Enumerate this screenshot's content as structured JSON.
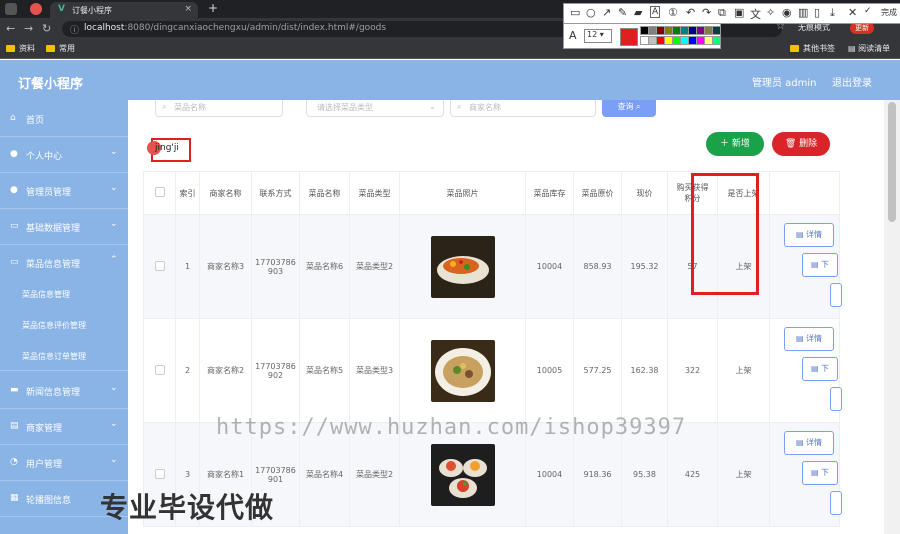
{
  "browser": {
    "tab_title": "订餐小程序",
    "new_tab": "+",
    "tab_close": "×",
    "url_host": "localhost",
    "url_rest": ":8080/dingcanxiaochengxu/admin/dist/index.html#/goods",
    "incognito": "无痕模式",
    "update": "更新",
    "bookmarks": [
      "资料",
      "常用"
    ],
    "bookmarks_right": [
      "其他书签",
      "阅读清单"
    ]
  },
  "screenshot_tool": {
    "font_size": "12",
    "done": "完成",
    "colors": [
      "#000000",
      "#808080",
      "#800000",
      "#808000",
      "#008000",
      "#008080",
      "#000080",
      "#800080",
      "#808040",
      "#004040",
      "#ffffff",
      "#c0c0c0",
      "#ff0000",
      "#ffff00",
      "#00ff00",
      "#00ffff",
      "#0000ff",
      "#ff00ff",
      "#ffff80",
      "#00ff80"
    ]
  },
  "app": {
    "title": "订餐小程序",
    "user": "管理员 admin",
    "logout": "退出登录"
  },
  "sidebar": {
    "items": [
      {
        "label": "首页",
        "icon": "home-icon"
      },
      {
        "label": "个人中心",
        "icon": "user-icon"
      },
      {
        "label": "管理员管理",
        "icon": "admin-icon"
      },
      {
        "label": "基础数据管理",
        "icon": "data-icon"
      },
      {
        "label": "菜品信息管理",
        "icon": "dish-icon"
      },
      {
        "label": "新闻信息管理",
        "icon": "news-icon"
      },
      {
        "label": "商家管理",
        "icon": "shop-icon"
      },
      {
        "label": "用户管理",
        "icon": "users-icon"
      },
      {
        "label": "轮播图信息",
        "icon": "carousel-icon"
      }
    ],
    "subitems": [
      "菜品信息管理",
      "菜品信息评价管理",
      "菜品信息订单管理"
    ]
  },
  "search": {
    "name_placeholder": "菜品名称",
    "type_placeholder": "请选择菜品类型",
    "shop_placeholder": "商家名称",
    "query_label": "查询"
  },
  "ime_text": "jing'ji",
  "toolbar": {
    "add_label": "新增",
    "delete_label": "删除"
  },
  "table": {
    "headers": [
      "索引",
      "商家名称",
      "联系方式",
      "菜品名称",
      "菜品类型",
      "菜品照片",
      "菜品库存",
      "菜品原价",
      "现价",
      "购买获得积分",
      "是否上架"
    ],
    "rows": [
      {
        "index": "1",
        "shop": "商家名称3",
        "phone": "17703786903",
        "name": "菜品名称6",
        "type": "菜品类型2",
        "stock": "10004",
        "price": "858.93",
        "now": "195.32",
        "points": "57",
        "status": "上架"
      },
      {
        "index": "2",
        "shop": "商家名称2",
        "phone": "17703786902",
        "name": "菜品名称5",
        "type": "菜品类型3",
        "stock": "10005",
        "price": "577.25",
        "now": "162.38",
        "points": "322",
        "status": "上架"
      },
      {
        "index": "3",
        "shop": "商家名称1",
        "phone": "17703786901",
        "name": "菜品名称4",
        "type": "菜品类型2",
        "stock": "10004",
        "price": "918.36",
        "now": "95.38",
        "points": "425",
        "status": "上架"
      }
    ],
    "op_detail": "详情",
    "op_edit": "下"
  },
  "watermark": {
    "url": "https://www.huzhan.com/ishop39397",
    "cn": "专业毕设代做"
  }
}
